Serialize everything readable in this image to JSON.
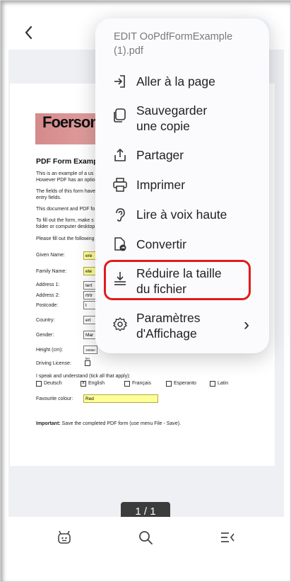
{
  "header": {
    "back_icon": "chevron-left-icon"
  },
  "menu": {
    "title": "EDIT OoPdfFormExample (1).pdf",
    "items": [
      {
        "label": "Aller à la page",
        "icon": "goto-page-icon"
      },
      {
        "label": "Sauvegarder\nune copie",
        "icon": "save-copy-icon"
      },
      {
        "label": "Partager",
        "icon": "share-icon"
      },
      {
        "label": "Imprimer",
        "icon": "printer-icon"
      },
      {
        "label": "Lire à voix haute",
        "icon": "read-aloud-icon"
      },
      {
        "label": "Convertir",
        "icon": "convert-icon"
      },
      {
        "label": "Réduire la taille\ndu fichier",
        "icon": "download-reduce-icon"
      },
      {
        "label": "Paramètres\nd'Affichage",
        "icon": "settings-gear-icon",
        "chevron": "›"
      }
    ]
  },
  "pdf": {
    "logo": "Foersom",
    "heading": "PDF Form Examp",
    "paras": [
      "This is an example of a us",
      "However PDF has an optio",
      "The fields of this form have",
      "entry fields.",
      "This document and PDF fo",
      "To fill out the form, make s",
      "folder or computer desktop",
      "Please fill out the following"
    ],
    "labels": {
      "given_name": "Given Name:",
      "family_name": "Family Name:",
      "address1": "Address 1:",
      "address2": "Address 2:",
      "postcode": "Postcode:",
      "country": "Country:",
      "gender": "Gender:",
      "height": "Height (cm):",
      "driving": "Driving License:",
      "speak": "I speak and understand (tick all that apply):",
      "fav": "Favourite colour:",
      "important_b": "Important:",
      "important": " Save the completed PDF form (use menu File - Save)."
    },
    "values": {
      "given_name": "ere",
      "family_name": "ete",
      "address1": "tert",
      "address2": "rtrtr",
      "postcode": "t",
      "country": "ert",
      "gender": "Mar",
      "height": "150der len",
      "fav": "Red"
    },
    "languages": [
      {
        "label": "Deutsch",
        "checked": ""
      },
      {
        "label": "English",
        "checked": "×"
      },
      {
        "label": "Français",
        "checked": ""
      },
      {
        "label": "Esperanto",
        "checked": ""
      },
      {
        "label": "Latin",
        "checked": ""
      }
    ]
  },
  "pager": "1 / 1",
  "bottom_bar": [
    "bot-icon",
    "search-icon",
    "menu-collapse-icon"
  ]
}
